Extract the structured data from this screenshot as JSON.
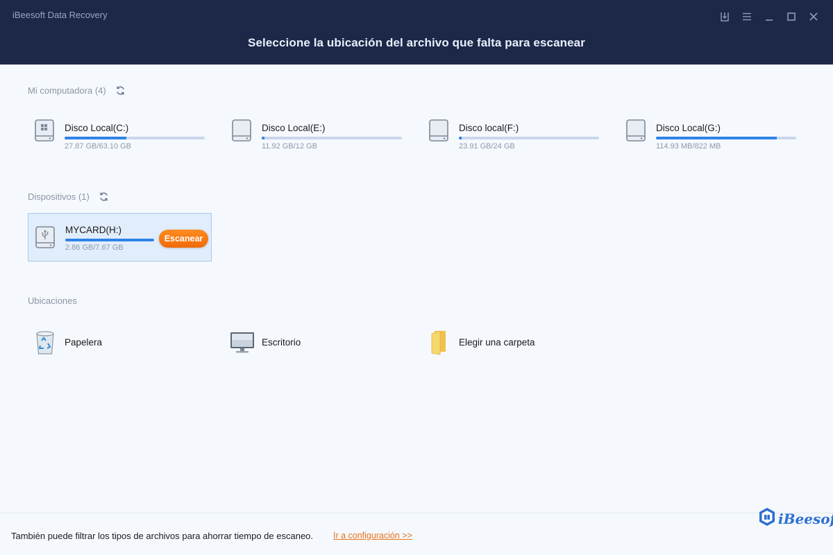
{
  "app_title": "iBeesoft Data Recovery",
  "main_title": "Seleccione la ubicación del archivo que falta para escanear",
  "window_controls": [
    "download-icon",
    "menu-icon",
    "minimize-icon",
    "maximize-icon",
    "close-icon"
  ],
  "my_computer": {
    "label": "Mi computadora (4)",
    "drives": [
      {
        "name": "Disco Local(C:)",
        "size": "27.87 GB/63.10 GB",
        "used_fraction": 0.44,
        "icon": "windows-drive-icon"
      },
      {
        "name": "Disco Local(E:)",
        "size": "11.92 GB/12 GB",
        "used_fraction": 0.02,
        "icon": "hard-drive-icon"
      },
      {
        "name": "Disco local(F:)",
        "size": "23.91 GB/24 GB",
        "used_fraction": 0.02,
        "icon": "hard-drive-icon"
      },
      {
        "name": "Disco Local(G:)",
        "size": "114.93 MB/822 MB",
        "used_fraction": 0.86,
        "icon": "hard-drive-icon"
      }
    ]
  },
  "devices": {
    "label": "Dispositivos (1)",
    "items": [
      {
        "name": "MYCARD(H:)",
        "size": "2.86 GB/7.67 GB",
        "used_fraction": 1.0,
        "icon": "usb-drive-icon",
        "scan_label": "Escanear"
      }
    ]
  },
  "locations": {
    "label": "Ubicaciones",
    "items": [
      {
        "name": "Papelera",
        "icon": "recycle-bin-icon"
      },
      {
        "name": "Escritorio",
        "icon": "desktop-icon"
      },
      {
        "name": "Elegir una carpeta",
        "icon": "folder-icon"
      }
    ]
  },
  "footer": {
    "text": "También puede filtrar los tipos de archivos para ahorrar tiempo de escaneo.",
    "link": "Ir a configuración >>"
  },
  "brand": "iBeesoft",
  "colors": {
    "header_bg": "#1d2848",
    "accent_blue": "#2f83e6",
    "scan_orange": "#f47a14",
    "link_orange": "#e8711a"
  }
}
